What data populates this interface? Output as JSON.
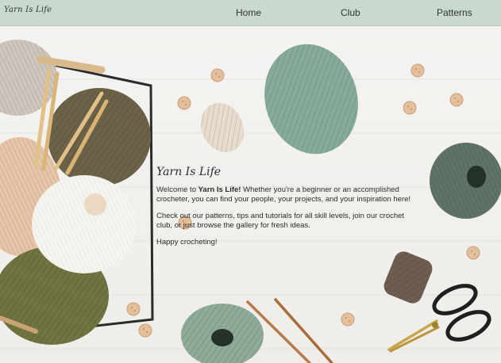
{
  "nav": {
    "logo": "Yarn Is Life",
    "links": [
      {
        "label": "Home"
      },
      {
        "label": "Club"
      },
      {
        "label": "Patterns"
      }
    ]
  },
  "hero": {
    "script_title": "Yarn Is Life",
    "intro_prefix": "Welcome to ",
    "intro_bold": "Yarn Is Life!",
    "intro_rest": " Whether you're a beginner or an accomplished crocheter, you can find your people, your projects, and your inspiration here!",
    "paragraph2": "Check out our patterns, tips and tutorials for all skill levels, join our crochet club, or just browse the gallery for fresh ideas.",
    "paragraph3": "Happy crocheting!"
  },
  "colors": {
    "nav_bg": "#c9d9cd",
    "sage_yarn": "#86ab9b",
    "dark_green_yarn": "#5f7466",
    "olive_yarn": "#6f7440",
    "brown_yarn": "#6e5e51"
  }
}
